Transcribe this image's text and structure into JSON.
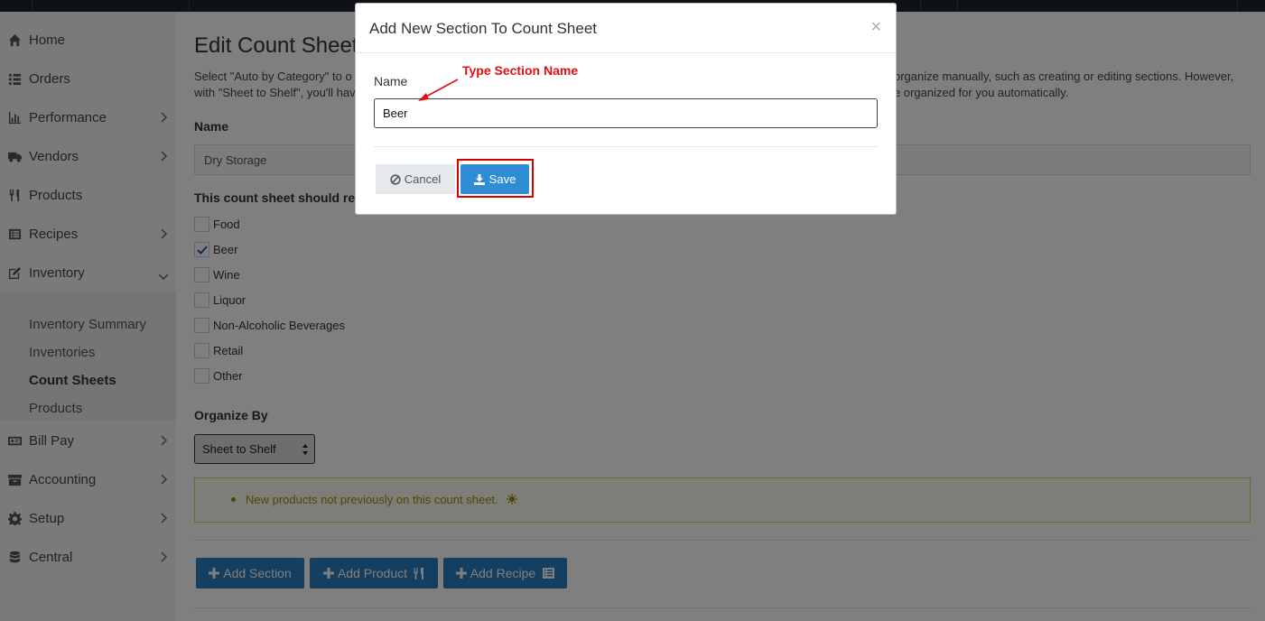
{
  "sidebar": {
    "items": [
      {
        "label": "Home",
        "icon": "home-icon"
      },
      {
        "label": "Orders",
        "icon": "list-icon"
      },
      {
        "label": "Performance",
        "icon": "bar-chart-icon"
      },
      {
        "label": "Vendors",
        "icon": "truck-icon"
      },
      {
        "label": "Products",
        "icon": "utensils-icon"
      },
      {
        "label": "Recipes",
        "icon": "list-alt-icon"
      },
      {
        "label": "Inventory",
        "icon": "edit-icon"
      },
      {
        "label": "Bill Pay",
        "icon": "money-bill-icon"
      },
      {
        "label": "Accounting",
        "icon": "archive-icon"
      },
      {
        "label": "Setup",
        "icon": "gear-icon"
      },
      {
        "label": "Central",
        "icon": "database-icon"
      }
    ],
    "inventory_submenu": [
      "Inventory Summary",
      "Inventories",
      "Count Sheets",
      "Products"
    ],
    "active_submenu": "Count Sheets"
  },
  "main": {
    "title": "Edit Count Sheet",
    "desc_line1_left": "Select \"Auto by Category\" to o",
    "desc_line1_right": "organize manually, such as creating or editing sections. However,",
    "desc_line2_left": "with \"Sheet to Shelf\", you'll hav",
    "desc_line2_right": "e organized for you automatically.",
    "name_label": "Name",
    "name_value": "Dry Storage",
    "receive_label": "This count sheet should rec",
    "categories": [
      {
        "label": "Food",
        "checked": false
      },
      {
        "label": "Beer",
        "checked": true
      },
      {
        "label": "Wine",
        "checked": false
      },
      {
        "label": "Liquor",
        "checked": false
      },
      {
        "label": "Non-Alcoholic Beverages",
        "checked": false
      },
      {
        "label": "Retail",
        "checked": false
      },
      {
        "label": "Other",
        "checked": false
      }
    ],
    "organize_label": "Organize By",
    "organize_value": "Sheet to Shelf",
    "alert_text": "New products not previously on this count sheet.",
    "buttons": {
      "add_section": "Add Section",
      "add_product": "Add Product",
      "add_recipe": "Add Recipe"
    }
  },
  "modal": {
    "title": "Add New Section To Count Sheet",
    "close": "×",
    "name_label": "Name",
    "name_value": "Beer",
    "cancel_label": "Cancel",
    "save_label": "Save"
  },
  "annotation": {
    "text": "Type Section Name",
    "color": "#e01010"
  },
  "colors": {
    "primary_button": "#2b7ec0",
    "save_button": "#2e8dd4",
    "highlight": "#d30000",
    "alert_text": "#a0890c"
  }
}
